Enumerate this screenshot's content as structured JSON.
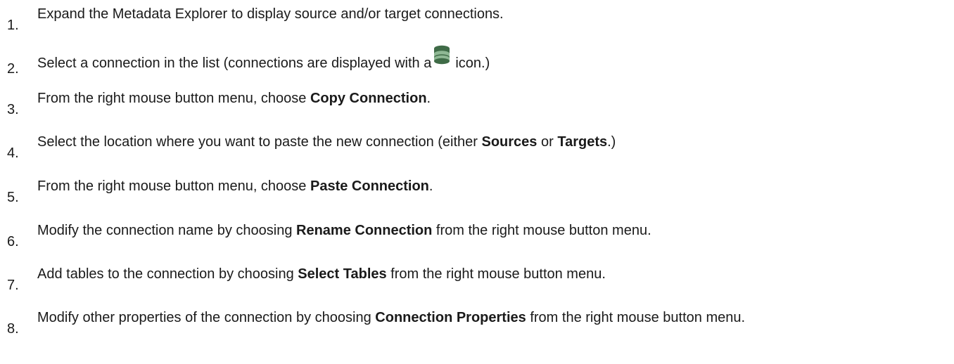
{
  "steps": [
    {
      "number": "1.",
      "parts": [
        "Expand the Metadata Explorer to display source and/or target connections."
      ]
    },
    {
      "number": "2.",
      "before": "Select a connection in the list (connections are displayed with a",
      "icon": "database-icon",
      "after": "icon.)"
    },
    {
      "number": "3.",
      "before": "From the right mouse button menu, choose ",
      "bold1": "Copy Connection",
      "after": "."
    },
    {
      "number": "4.",
      "before": "Select the location where you want to paste the new connection (either ",
      "bold1": "Sources",
      "middle": " or ",
      "bold2": "Targets",
      "after": ".)"
    },
    {
      "number": "5.",
      "before": "From the right mouse button menu, choose ",
      "bold1": "Paste Connection",
      "after": "."
    },
    {
      "number": "6.",
      "before": "Modify the connection name by choosing ",
      "bold1": "Rename Connection",
      "after": " from the right mouse button menu."
    },
    {
      "number": "7.",
      "before": "Add tables to the connection by choosing ",
      "bold1": "Select Tables",
      "after": " from the right mouse button menu."
    },
    {
      "number": "8.",
      "before": "Modify other properties of the connection by choosing ",
      "bold1": "Connection Properties",
      "after": " from the right mouse button menu."
    }
  ],
  "colors": {
    "text": "#1a1a1a",
    "icon_dark": "#3f6b47",
    "icon_light": "#8fb894"
  }
}
